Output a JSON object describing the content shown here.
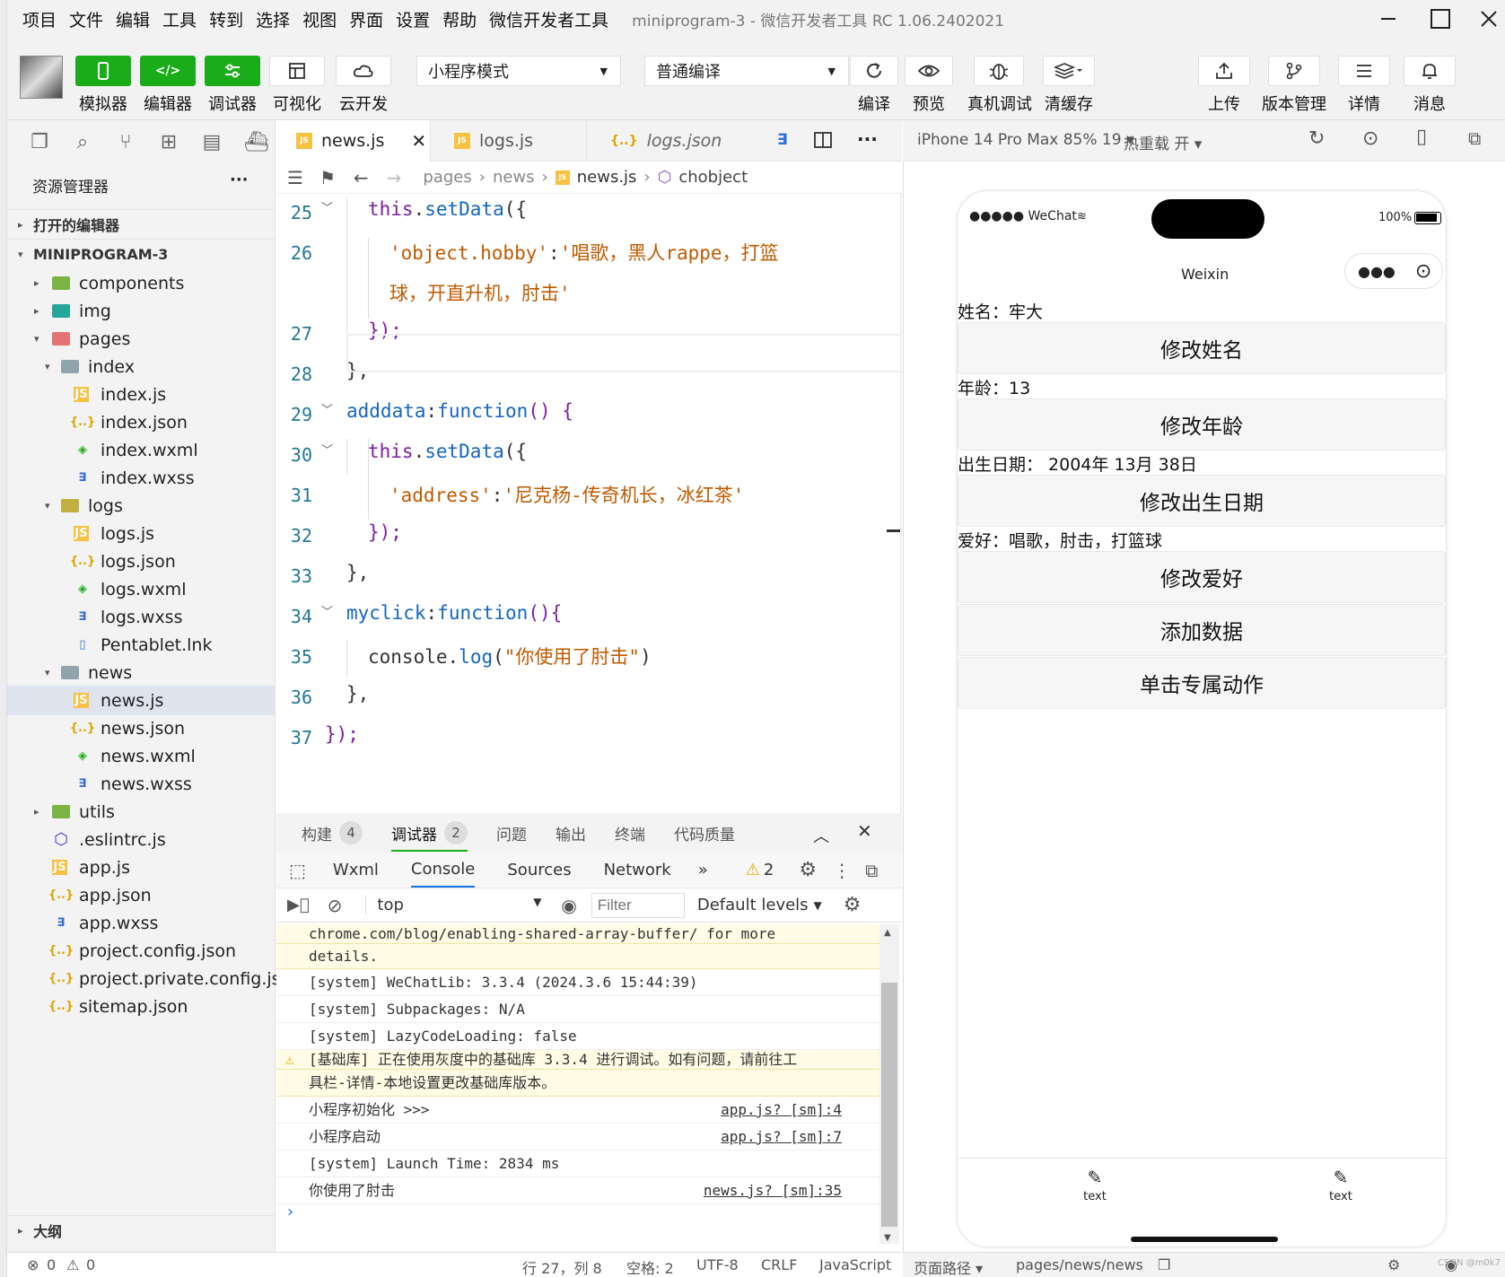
{
  "menubar": {
    "items": [
      "项目",
      "文件",
      "编辑",
      "工具",
      "转到",
      "选择",
      "视图",
      "界面",
      "设置",
      "帮助",
      "微信开发者工具"
    ],
    "window_title": "miniprogram-3 - 微信开发者工具 RC 1.06.2402021"
  },
  "toolbar": {
    "simulator": "模拟器",
    "editor": "编辑器",
    "debugger": "调试器",
    "visual": "可视化",
    "cloud": "云开发",
    "mode_select": "小程序模式",
    "compile_select": "普通编译",
    "compile": "编译",
    "preview": "预览",
    "real_debug": "真机调试",
    "clear_cache": "清缓存",
    "upload": "上传",
    "version": "版本管理",
    "details": "详情",
    "messages": "消息"
  },
  "explorer": {
    "title": "资源管理器",
    "more": "···",
    "open_editors": "打开的编辑器",
    "project": "MINIPROGRAM-3",
    "outline": "大纲",
    "tree": [
      {
        "label": "components",
        "type": "folder-green",
        "depth": 1,
        "twisty": "▸"
      },
      {
        "label": "img",
        "type": "folder-teal",
        "depth": 1,
        "twisty": "▸"
      },
      {
        "label": "pages",
        "type": "folder-red",
        "depth": 1,
        "twisty": "▾"
      },
      {
        "label": "index",
        "type": "folder-gray",
        "depth": 2,
        "twisty": "▾"
      },
      {
        "label": "index.js",
        "type": "js",
        "depth": 3
      },
      {
        "label": "index.json",
        "type": "json",
        "depth": 3
      },
      {
        "label": "index.wxml",
        "type": "wxml",
        "depth": 3
      },
      {
        "label": "index.wxss",
        "type": "wxss",
        "depth": 3
      },
      {
        "label": "logs",
        "type": "folder-yellow",
        "depth": 2,
        "twisty": "▾"
      },
      {
        "label": "logs.js",
        "type": "js",
        "depth": 3
      },
      {
        "label": "logs.json",
        "type": "json",
        "depth": 3
      },
      {
        "label": "logs.wxml",
        "type": "wxml",
        "depth": 3
      },
      {
        "label": "logs.wxss",
        "type": "wxss",
        "depth": 3
      },
      {
        "label": "Pentablet.lnk",
        "type": "file",
        "depth": 3
      },
      {
        "label": "news",
        "type": "folder-gray",
        "depth": 2,
        "twisty": "▾"
      },
      {
        "label": "news.js",
        "type": "js",
        "depth": 3,
        "selected": true
      },
      {
        "label": "news.json",
        "type": "json",
        "depth": 3
      },
      {
        "label": "news.wxml",
        "type": "wxml",
        "depth": 3
      },
      {
        "label": "news.wxss",
        "type": "wxss",
        "depth": 3
      },
      {
        "label": "utils",
        "type": "folder-green",
        "depth": 1,
        "twisty": "▸"
      },
      {
        "label": ".eslintrc.js",
        "type": "eslint",
        "depth": 1
      },
      {
        "label": "app.js",
        "type": "js",
        "depth": 1
      },
      {
        "label": "app.json",
        "type": "json",
        "depth": 1
      },
      {
        "label": "app.wxss",
        "type": "wxss",
        "depth": 1
      },
      {
        "label": "project.config.json",
        "type": "json",
        "depth": 1
      },
      {
        "label": "project.private.config.js...",
        "type": "json",
        "depth": 1
      },
      {
        "label": "sitemap.json",
        "type": "json",
        "depth": 1
      }
    ]
  },
  "editor": {
    "tabs": [
      {
        "label": "news.js",
        "active": true
      },
      {
        "label": "logs.js",
        "active": false
      },
      {
        "label": "logs.json",
        "active": false
      }
    ],
    "breadcrumb": [
      "pages",
      "news",
      "news.js",
      "chobject"
    ],
    "lines": [
      {
        "n": "25",
        "parts": [
          [
            "this",
            "k-purple"
          ],
          [
            ".",
            "k-plain"
          ],
          [
            "setData",
            "k-fn"
          ],
          [
            "({",
            "k-plain"
          ]
        ],
        "indent": 1
      },
      {
        "n": "26",
        "parts": [
          [
            "'object.hobby'",
            "k-str"
          ],
          [
            ":",
            "k-plain"
          ],
          [
            "'唱歌，黑人rappe，打篮",
            "k-str"
          ]
        ],
        "indent": 2
      },
      {
        "n": "",
        "parts": [
          [
            "球，开直升机，肘击'",
            "k-str"
          ]
        ],
        "indent": 2
      },
      {
        "n": "27",
        "parts": [
          [
            "});",
            "k-purple"
          ]
        ],
        "indent": 1
      },
      {
        "n": "28",
        "parts": [
          [
            "},",
            "k-plain"
          ]
        ],
        "indent": 0
      },
      {
        "n": "29",
        "parts": [
          [
            "adddata",
            "k-fn"
          ],
          [
            ":",
            "k-plain"
          ],
          [
            "function",
            "k-fn"
          ],
          [
            "() {",
            "k-purple"
          ]
        ],
        "indent": 0
      },
      {
        "n": "30",
        "parts": [
          [
            "this",
            "k-purple"
          ],
          [
            ".",
            "k-plain"
          ],
          [
            "setData",
            "k-fn"
          ],
          [
            "({",
            "k-plain"
          ]
        ],
        "indent": 1
      },
      {
        "n": "31",
        "parts": [
          [
            "'address'",
            "k-str"
          ],
          [
            ":",
            "k-plain"
          ],
          [
            "'尼克杨-传奇机长，冰红茶'",
            "k-str"
          ]
        ],
        "indent": 2
      },
      {
        "n": "32",
        "parts": [
          [
            "});",
            "k-purple"
          ]
        ],
        "indent": 1
      },
      {
        "n": "33",
        "parts": [
          [
            "},",
            "k-plain"
          ]
        ],
        "indent": 0
      },
      {
        "n": "34",
        "parts": [
          [
            "myclick",
            "k-fn"
          ],
          [
            ":",
            "k-plain"
          ],
          [
            "function",
            "k-fn"
          ],
          [
            "(){",
            "k-purple"
          ]
        ],
        "indent": 0
      },
      {
        "n": "35",
        "parts": [
          [
            "console",
            "k-plain"
          ],
          [
            ".",
            "k-plain"
          ],
          [
            "log",
            "k-fn"
          ],
          [
            "(",
            "k-plain"
          ],
          [
            "\"你使用了肘击\"",
            "k-str"
          ],
          [
            ")",
            "k-plain"
          ]
        ],
        "indent": 1
      },
      {
        "n": "36",
        "parts": [
          [
            "},",
            "k-plain"
          ]
        ],
        "indent": 0
      },
      {
        "n": "37",
        "parts": [
          [
            "});",
            "k-purple"
          ]
        ],
        "indent": -1
      }
    ]
  },
  "bottom_panel": {
    "tabs": [
      {
        "label": "构建",
        "count": "4"
      },
      {
        "label": "调试器",
        "count": "2"
      },
      {
        "label": "问题",
        "count": ""
      },
      {
        "label": "输出",
        "count": ""
      },
      {
        "label": "终端",
        "count": ""
      },
      {
        "label": "代码质量",
        "count": ""
      }
    ],
    "devtabs": [
      "Wxml",
      "Console",
      "Sources",
      "Network"
    ],
    "more": "»",
    "warn_count": "2",
    "context": "top",
    "filter_placeholder": "Filter",
    "levels": "Default levels",
    "console_lines": [
      {
        "text": "chrome.com/blog/enabling-shared-array-buffer/ for more",
        "warn": true,
        "src": ""
      },
      {
        "text": "details.",
        "warn": true,
        "src": ""
      },
      {
        "text": "[system] WeChatLib: 3.3.4 (2024.3.6 15:44:39)",
        "warn": false,
        "src": ""
      },
      {
        "text": "[system] Subpackages: N/A",
        "warn": false,
        "src": ""
      },
      {
        "text": "[system] LazyCodeLoading: false",
        "warn": false,
        "src": ""
      },
      {
        "text": "[基础库] 正在使用灰度中的基础库 3.3.4 进行调试。如有问题，请前往工",
        "warn": true,
        "src": ""
      },
      {
        "text": "具栏-详情-本地设置更改基础库版本。",
        "warn": true,
        "src": ""
      },
      {
        "text": "小程序初始化  >>>",
        "warn": false,
        "src": "app.js? [sm]:4"
      },
      {
        "text": "小程序启动",
        "warn": false,
        "src": "app.js? [sm]:7"
      },
      {
        "text": "[system] Launch Time: 2834 ms",
        "warn": false,
        "src": ""
      },
      {
        "text": "你使用了肘击",
        "warn": false,
        "src": "news.js? [sm]:35"
      }
    ],
    "prompt": "›"
  },
  "statusbar": {
    "errors": "0",
    "warnings": "0",
    "position": "行 27，列 8",
    "spaces": "空格: 2",
    "encoding": "UTF-8",
    "eol": "CRLF",
    "language": "JavaScript"
  },
  "simulator": {
    "device": "iPhone 14 Pro Max 85% 19 ▾",
    "hot_reload": "热重载 开 ▾",
    "carrier": "●●●●● WeChat",
    "battery": "100%",
    "nav_title": "Weixin",
    "name_label": "姓名：牢大",
    "btn_name": "修改姓名",
    "age_label": "年龄：13",
    "btn_age": "修改年龄",
    "birth_label": "出生日期： 2004年 13月 38日",
    "btn_birth": "修改出生日期",
    "hobby_label": "爱好：唱歌，肘击，打篮球",
    "btn_hobby": "修改爱好",
    "btn_add": "添加数据",
    "btn_click": "单击专属动作",
    "tab1": "text",
    "tab2": "text",
    "page_path_label": "页面路径 ▾",
    "page_path": "pages/news/news",
    "watermark": "CSDN @m0k7"
  }
}
